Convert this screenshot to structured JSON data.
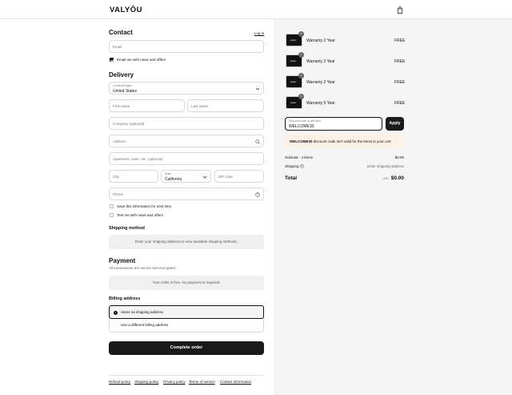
{
  "header": {
    "logo": "VALYŌU",
    "cart_icon": "shopping-bag-icon"
  },
  "contact": {
    "title": "Contact",
    "login_link": "Log in",
    "email_placeholder": "Email",
    "news_label": "Email me with news and offers",
    "news_checked": true
  },
  "delivery": {
    "title": "Delivery",
    "country_label": "Country/Region",
    "country_value": "United States",
    "first_name": "First name",
    "last_name": "Last name",
    "company": "Company (optional)",
    "address": "Address",
    "apartment": "Apartment, suite, etc. (optional)",
    "city": "City",
    "state_label": "State",
    "state_value": "California",
    "zip": "ZIP code",
    "phone": "Phone",
    "save_info": "Save this information for next time",
    "text_news": "Text me with news and offers"
  },
  "shipping": {
    "title": "Shipping method",
    "info": "Enter your shipping address to view available shipping methods."
  },
  "payment": {
    "title": "Payment",
    "subtitle": "All transactions are secure and encrypted.",
    "info": "Your order is free. No payment is required."
  },
  "billing": {
    "title": "Billing address",
    "options": [
      "Same as shipping address",
      "Use a different billing address"
    ],
    "selected": 0
  },
  "cta": "Complete order",
  "footer_links": [
    "Refund policy",
    "Shipping policy",
    "Privacy policy",
    "Terms of service",
    "Contact information"
  ],
  "summary": {
    "items": [
      {
        "qty": "1",
        "thumb": "proper",
        "name": "Warranty 2 Year",
        "price": "FREE"
      },
      {
        "qty": "1",
        "thumb": "proper",
        "name": "Warranty 2 Year",
        "price": "FREE"
      },
      {
        "qty": "1",
        "thumb": "proper",
        "name": "Warranty 2 Year",
        "price": "FREE"
      },
      {
        "qty": "1",
        "thumb": "proper",
        "name": "Warranty 5 Year",
        "price": "FREE"
      }
    ],
    "discount_label": "Discount code or gift card",
    "discount_value": "WELCOME30",
    "apply": "Apply",
    "warning_code": "WELCOME30",
    "warning_text": "discount code isn't valid for the items in your cart",
    "subtotal_label": "Subtotal · 4 items",
    "subtotal_value": "$0.00",
    "shipping_label": "Shipping",
    "shipping_value": "Enter shipping address",
    "total_label": "Total",
    "currency": "USD",
    "total_value": "$0.00"
  }
}
